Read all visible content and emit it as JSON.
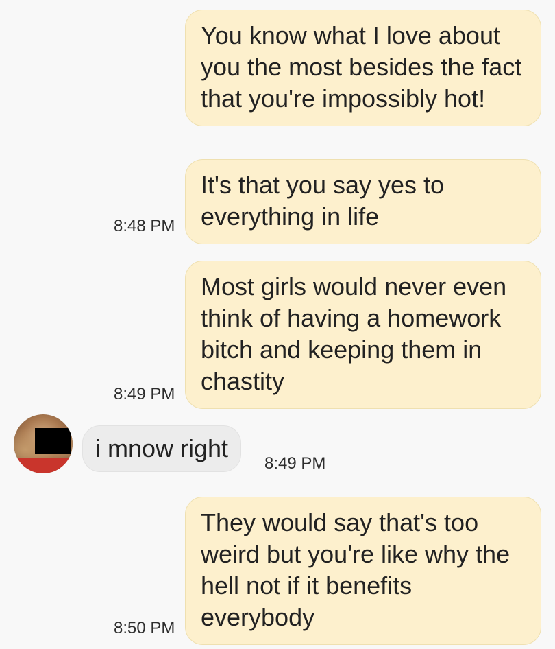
{
  "messages": [
    {
      "text": "You know what I love about you the most besides the fact that you're impossibly hot!",
      "time": ""
    },
    {
      "text": "It's that you say yes to everything in life",
      "time": "8:48 PM"
    },
    {
      "text": "Most girls would never even think of having a homework bitch and keeping them in chastity",
      "time": "8:49 PM"
    },
    {
      "text": "i mnow right",
      "time": "8:49 PM"
    },
    {
      "text": "They would say that's too weird but you're like why the hell not if it benefits everybody",
      "time": "8:50 PM"
    }
  ],
  "colors": {
    "sent_bubble": "#fdf0cd",
    "received_bubble": "#ececec",
    "background": "#f8f8f8"
  }
}
